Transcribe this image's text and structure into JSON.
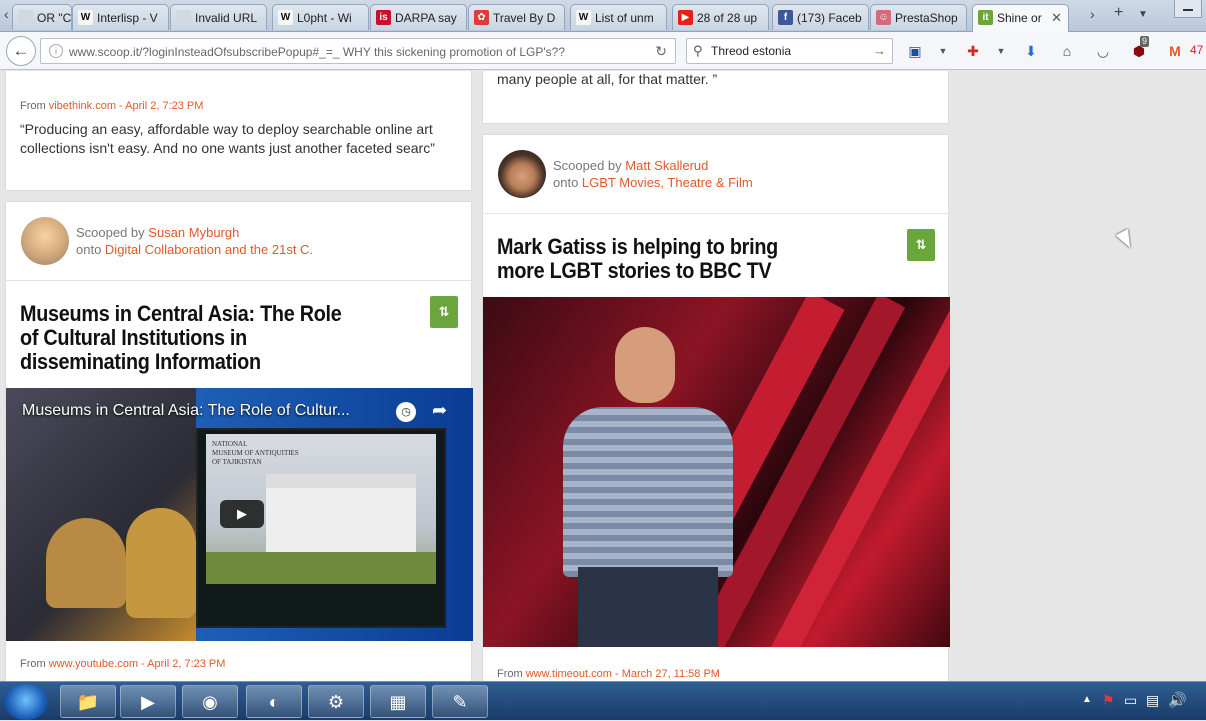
{
  "browser": {
    "tabs": [
      {
        "label": "OR \"Co",
        "favicon_text": "",
        "favicon_color": "#d0d8e2"
      },
      {
        "label": "Interlisp - V",
        "favicon_text": "W",
        "favicon_color": "#f6f6f6"
      },
      {
        "label": "Invalid URL",
        "favicon_text": "",
        "favicon_color": "#d0d8e2"
      },
      {
        "label": "L0pht - Wi",
        "favicon_text": "W",
        "favicon_color": "#f6f6f6"
      },
      {
        "label": "DARPA say",
        "favicon_text": "is",
        "favicon_color": "#c8102e"
      },
      {
        "label": "Travel By D",
        "favicon_text": "✿",
        "favicon_color": "#e03a3a"
      },
      {
        "label": "List of unm",
        "favicon_text": "W",
        "favicon_color": "#f6f6f6"
      },
      {
        "label": "28 of 28 up",
        "favicon_text": "▶",
        "favicon_color": "#e62117"
      },
      {
        "label": "(173) Faceb",
        "favicon_text": "f",
        "favicon_color": "#3b5998"
      },
      {
        "label": "PrestaShop",
        "favicon_text": "☺",
        "favicon_color": "#d56a7a"
      },
      {
        "label": "Shine or",
        "favicon_text": "it",
        "favicon_color": "#6aa63b",
        "active": true
      }
    ],
    "address_bar": "www.scoop.it/?loginInsteadOfsubscribePopup#_=_ WHY this sickening promotion of LGP's??",
    "search_box": "Threod estonia",
    "adblock_count": "9",
    "toolbar_number": "47"
  },
  "feed": {
    "left_top_card": {
      "from_prefix": "From ",
      "from_link": "vibethink.com",
      "date": " - April 2, 7:23 PM",
      "quote": "“Producing an easy, affordable way to deploy searchable online art collections isn't easy. And no one wants just another faceted searc”"
    },
    "right_top_card": {
      "quote_tail": "many people at all, for that matter. ”"
    },
    "left_card": {
      "scooped_prefix": "Scooped by ",
      "scooper": "Susan Myburgh",
      "onto_prefix": "onto ",
      "topic": "Digital Collaboration and the 21st C.",
      "title": "Museums in Central Asia: The Role of Cultural Institutions in disseminating Information",
      "video_title": "Museums in Central Asia: The Role of Cultur...",
      "video_slide_lines": [
        "NATIONAL",
        "MUSEUM OF ANTIQUITIES",
        "OF TAJIKISTAN"
      ],
      "from_prefix": "From ",
      "from_link": "www.youtube.com",
      "date": " - April 2, 7:23 PM"
    },
    "right_card": {
      "scooped_prefix": "Scooped by ",
      "scooper": "Matt Skallerud",
      "onto_prefix": "onto ",
      "topic": "LGBT Movies, Theatre & Film",
      "title": "Mark Gatiss is helping to bring more LGBT stories to BBC TV",
      "from_prefix": "From ",
      "from_link": "www.timeout.com",
      "date": " - March 27, 11:58 PM"
    },
    "rescoop_icon": "rescoop-icon"
  },
  "colors": {
    "accent": "#e0592a",
    "rescoop_green": "#6aa63b"
  }
}
